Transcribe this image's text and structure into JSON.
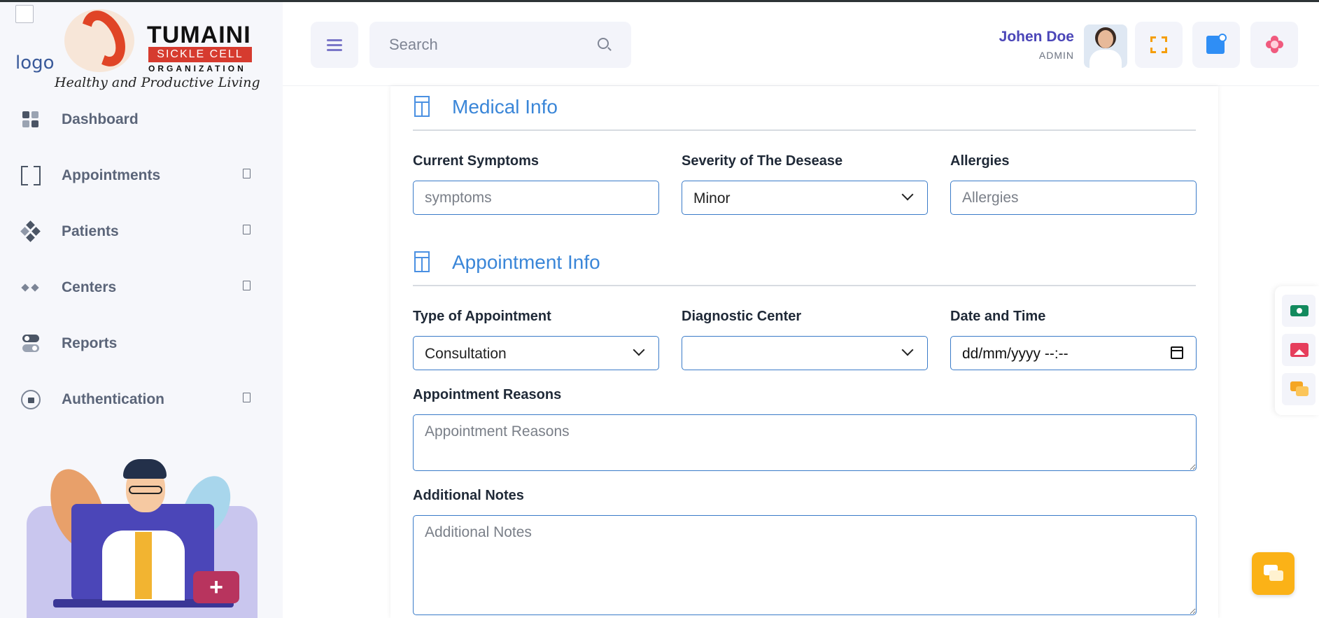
{
  "sidebar": {
    "logo_alt": "logo",
    "brand": {
      "title": "TUMAINI",
      "subtitle": "SICKLE CELL",
      "org": "ORGANIZATION",
      "tagline": "Healthy and Productive Living"
    },
    "items": [
      {
        "label": "Dashboard",
        "icon": "dashboard-icon"
      },
      {
        "label": "Appointments",
        "icon": "appointments-icon"
      },
      {
        "label": "Patients",
        "icon": "patients-icon"
      },
      {
        "label": "Centers",
        "icon": "centers-icon"
      },
      {
        "label": "Reports",
        "icon": "reports-icon"
      },
      {
        "label": "Authentication",
        "icon": "lock-icon"
      }
    ]
  },
  "header": {
    "search_placeholder": "Search",
    "user": {
      "name": "Johen Doe",
      "role": "ADMIN"
    },
    "buttons": [
      "fullscreen-icon",
      "messages-icon",
      "theme-icon"
    ]
  },
  "medical": {
    "title": "Medical Info",
    "symptoms_label": "Current Symptoms",
    "symptoms_placeholder": "symptoms",
    "severity_label": "Severity of The Desease",
    "severity_value": "Minor",
    "allergies_label": "Allergies",
    "allergies_placeholder": "Allergies"
  },
  "appointment": {
    "title": "Appointment Info",
    "type_label": "Type of Appointment",
    "type_value": "Consultation",
    "center_label": "Diagnostic Center",
    "center_value": "",
    "datetime_label": "Date and Time",
    "datetime_value": "dd/mm/yyyy --:--",
    "reasons_label": "Appointment Reasons",
    "reasons_placeholder": "Appointment Reasons",
    "notes_label": "Additional Notes",
    "notes_placeholder": "Additional Notes"
  },
  "colors": {
    "accent": "#4b46b8",
    "section_title": "#3a86d8",
    "field_border": "#3a7bc8",
    "fab": "#fbb217"
  }
}
